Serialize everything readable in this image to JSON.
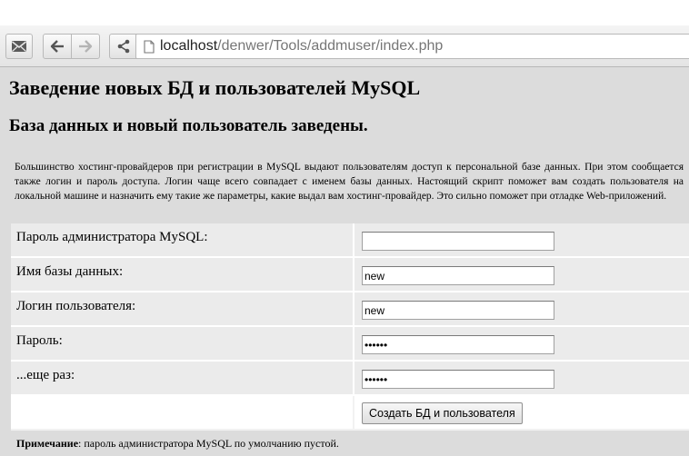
{
  "browser": {
    "url_host": "localhost",
    "url_path": "/denwer/Tools/addmuser/index.php",
    "icons": [
      "mail-icon",
      "back-arrow-icon",
      "forward-arrow-icon",
      "share-icon",
      "page-icon"
    ]
  },
  "page": {
    "title": "Заведение новых БД и пользователей MySQL",
    "subtitle": "База данных и новый пользователь заведены.",
    "intro": "Большинство хостинг-провайдеров при регистрации в MySQL выдают пользователям доступ к персональной базе данных. При этом сообщается также логин и пароль доступа. Логин чаще всего совпадает с именем базы данных. Настоящий скрипт поможет вам создать пользователя на локальной машине и назначить ему такие же параметры, какие выдал вам хостинг-провайдер. Это сильно поможет при отладке Web-приложений."
  },
  "form": {
    "rows": [
      {
        "label": "Пароль администратора MySQL:",
        "value": ""
      },
      {
        "label": "Имя базы данных:",
        "value": "new"
      },
      {
        "label": "Логин пользователя:",
        "value": "new"
      },
      {
        "label": "Пароль:",
        "value": "••••••"
      },
      {
        "label": "...еще раз:",
        "value": "••••••"
      }
    ],
    "submit_label": "Создать БД и пользователя"
  },
  "note": {
    "label": "Примечание",
    "text": ": пароль администратора MySQL по умолчанию пустой."
  }
}
